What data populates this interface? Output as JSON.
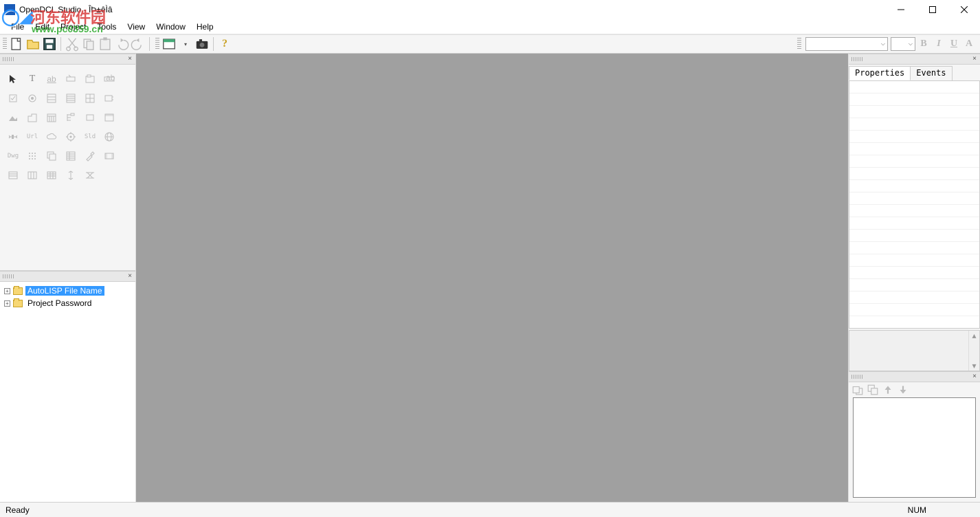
{
  "title": "OpenDCL Studio - ÎÞ±êÌâ",
  "watermark": {
    "brand": "河东软件园",
    "url": "www.pc0359.cn"
  },
  "menus": [
    "File",
    "Edit",
    "Project",
    "Tools",
    "View",
    "Window",
    "Help"
  ],
  "toolbar_icons": {
    "new": "new-file-icon",
    "open": "open-folder-icon",
    "save": "save-icon",
    "cut": "cut-icon",
    "copy": "copy-icon",
    "paste": "paste-icon",
    "undo": "undo-icon",
    "redo": "redo-icon",
    "window": "window-icon",
    "camera": "camera-icon",
    "help": "help-icon"
  },
  "fmt_labels": {
    "bold": "B",
    "italic": "I",
    "underline": "U",
    "align": "A"
  },
  "font_combo": "",
  "size_combo": "",
  "toolbox_tools": [
    "pointer",
    "T",
    "ab",
    "cursor",
    "panel",
    "ab-box",
    "check",
    "radio",
    "list1",
    "list2",
    "grid",
    "frame",
    "shape",
    "corner",
    "table",
    "tree",
    "rect",
    "group",
    "arrow",
    "Url",
    "cloud",
    "gear",
    "Sld",
    "globe",
    "Dwg",
    "dots",
    "stack",
    "props",
    "tools",
    "media",
    "col1",
    "col2",
    "col3",
    "align-v",
    "align-h"
  ],
  "tree": {
    "items": [
      {
        "label": "AutoLISP File Name",
        "selected": true
      },
      {
        "label": "Project Password",
        "selected": false
      }
    ]
  },
  "props_tabs": {
    "properties": "Properties",
    "events": "Events"
  },
  "status": {
    "left": "Ready",
    "right": "NUM"
  }
}
